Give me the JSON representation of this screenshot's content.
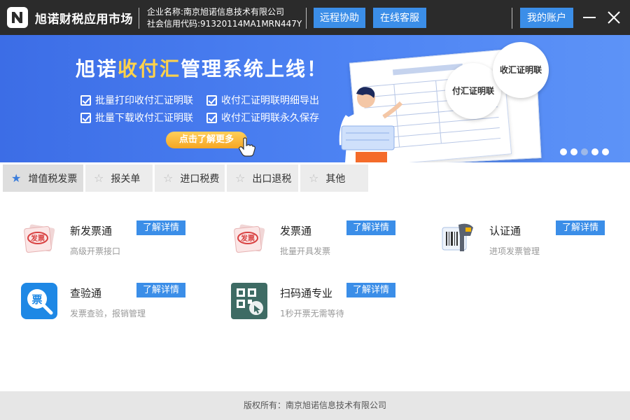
{
  "titlebar": {
    "app_title": "旭诺财税应用市场",
    "company_name": "企业名称:南京旭诺信息技术有限公司",
    "credit_code": "社会信用代码:91320114MA1MRN447Y",
    "remote_help": "远程协助",
    "online_service": "在线客服",
    "my_account": "我的账户"
  },
  "banner": {
    "title_prefix": "旭诺",
    "title_highlight": "收付汇",
    "title_suffix": "管理系统上线！",
    "features": [
      "批量打印收付汇证明联",
      "收付汇证明联明细导出",
      "批量下载收付汇证明联",
      "收付汇证明联永久保存"
    ],
    "cta": "点击了解更多",
    "badge_1": "付汇证明联",
    "badge_2": "收汇证明联",
    "active_dot": 3
  },
  "tabs": [
    {
      "label": "增值税发票"
    },
    {
      "label": "报关单"
    },
    {
      "label": "进口税费"
    },
    {
      "label": "出口退税"
    },
    {
      "label": "其他"
    }
  ],
  "apps": [
    {
      "name": "新发票通",
      "desc": "高级开票接口",
      "icon": "invoice-stamp-icon",
      "button": "了解详情"
    },
    {
      "name": "发票通",
      "desc": "批量开具发票",
      "icon": "invoice-stamp-icon",
      "button": "了解详情"
    },
    {
      "name": "认证通",
      "desc": "进项发票管理",
      "icon": "barcode-scanner-icon",
      "button": "了解详情"
    },
    {
      "name": "查验通",
      "desc": "发票查验，报销管理",
      "icon": "invoice-search-icon",
      "button": "了解详情"
    },
    {
      "name": "扫码通专业",
      "desc": "1秒开票无需等待",
      "icon": "qr-scan-icon",
      "button": "了解详情"
    }
  ],
  "footer": {
    "copyright": "版权所有：南京旭诺信息技术有限公司"
  },
  "colors": {
    "titlebar": "#2b2b2b",
    "accent": "#3b8ee8",
    "banner": "#4d83f3",
    "highlight": "#ffd24a"
  }
}
